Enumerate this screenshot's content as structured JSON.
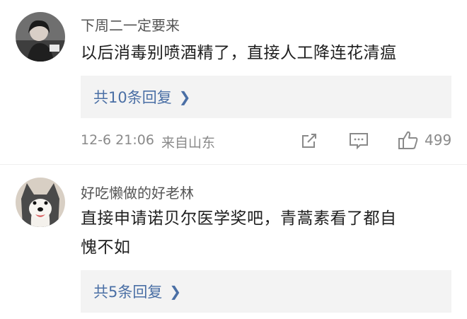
{
  "comments": [
    {
      "username": "下周二一定要来",
      "text": "以后消毒别喷酒精了，直接人工降连花清瘟",
      "replies_label": "共10条回复",
      "timestamp": "12-6 21:06",
      "source": "来自山东",
      "likes": "499",
      "avatar_icon": "person-photo-avatar"
    },
    {
      "username": "好吃懒做的好老林",
      "text_line1": "直接申请诺贝尔医学奖吧，青蒿素看了都自",
      "text_line2": "愧不如",
      "replies_label": "共5条回复",
      "avatar_icon": "husky-dog-avatar"
    }
  ],
  "icons": {
    "reply_chevron": "chevron-right-icon",
    "share": "share-icon",
    "comment": "comment-icon",
    "like": "thumbs-up-icon"
  },
  "colors": {
    "link_blue": "#4a6fa5",
    "meta_gray": "#8a8a8a",
    "reply_bg": "#f3f3f3"
  }
}
